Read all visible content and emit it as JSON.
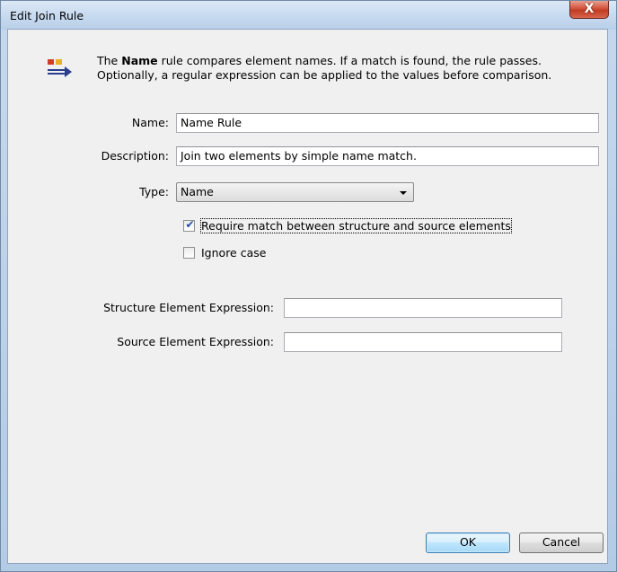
{
  "window": {
    "title": "Edit Join Rule",
    "close_label": "X"
  },
  "header": {
    "icon": "join-rule-icon",
    "desc_prefix": "The ",
    "desc_bold": "Name",
    "desc_rest_line1": " rule compares element names. If a match is found, the rule passes.",
    "desc_line2": "Optionally, a regular expression can be applied to the values before comparison."
  },
  "form": {
    "name_label": "Name:",
    "name_value": "Name Rule",
    "description_label": "Description:",
    "description_value": "Join two elements by simple name match.",
    "type_label": "Type:",
    "type_value": "Name",
    "require_match_label": "Require match between structure and source elements",
    "require_match_checked": true,
    "ignore_case_label": "Ignore case",
    "ignore_case_checked": false,
    "structure_expr_label": "Structure Element Expression:",
    "structure_expr_value": "",
    "source_expr_label": "Source Element Expression:",
    "source_expr_value": ""
  },
  "buttons": {
    "ok": "OK",
    "cancel": "Cancel"
  },
  "colors": {
    "accent": "#3c7fb1",
    "check": "#1f4ea5",
    "titlebar": "#c6d9ef"
  }
}
